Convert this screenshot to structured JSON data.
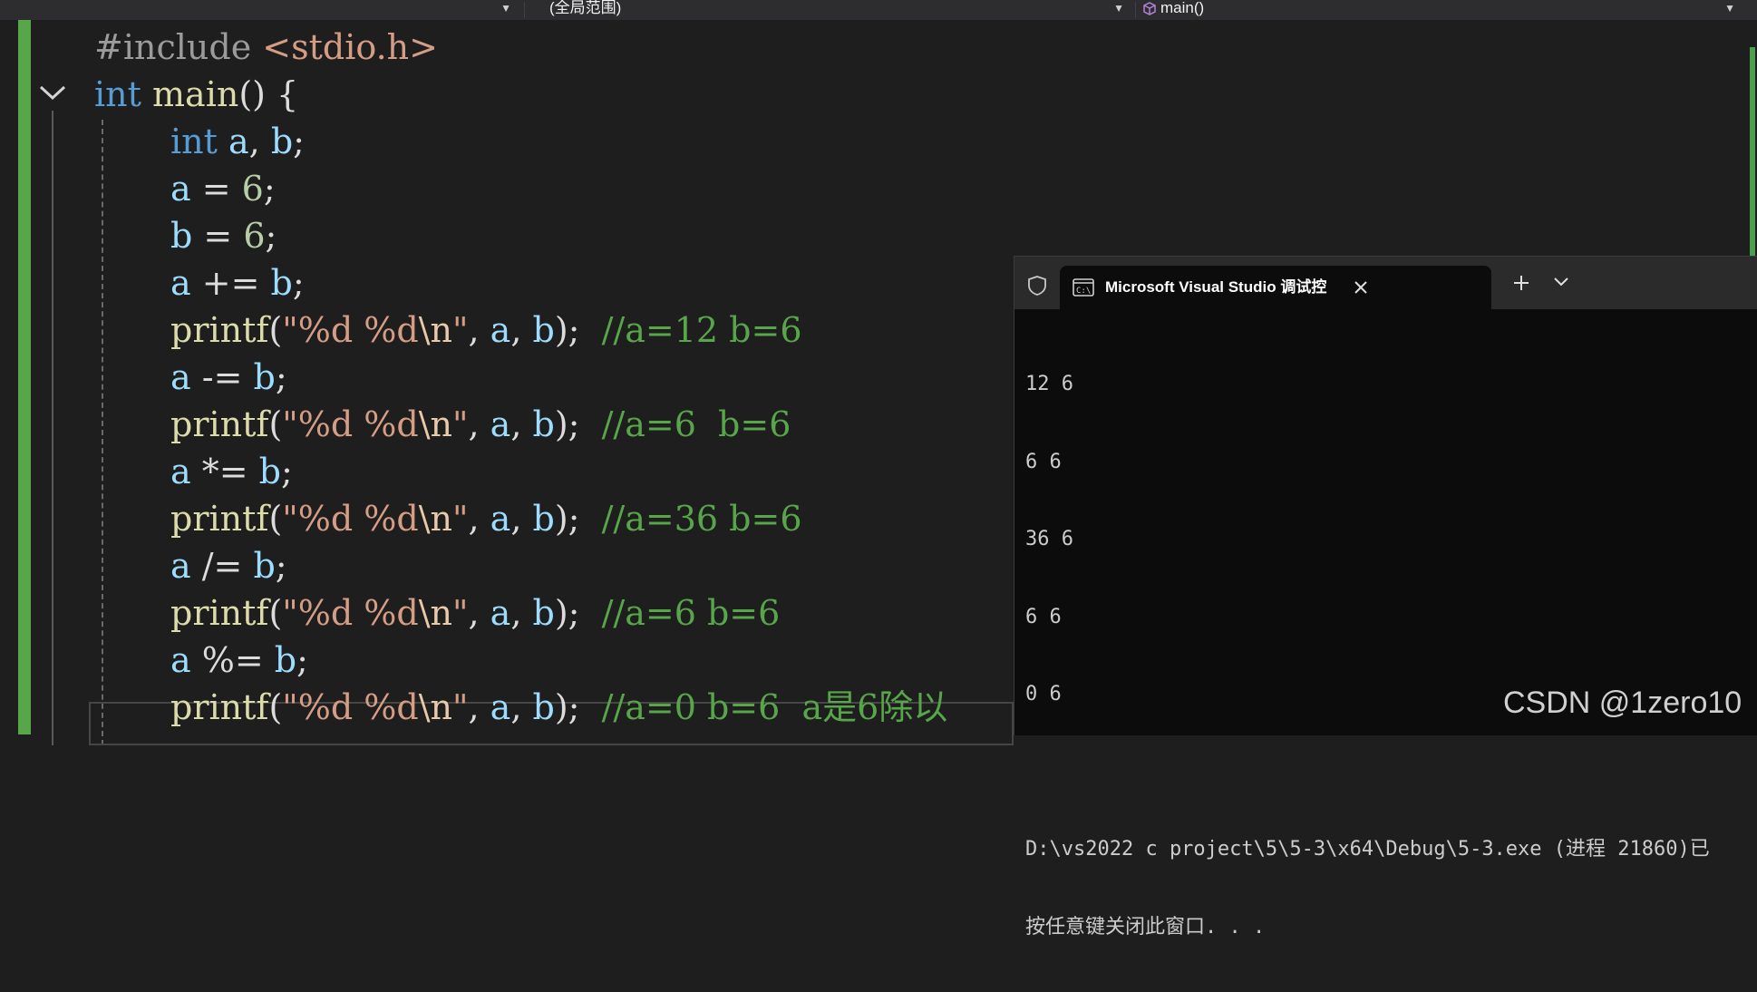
{
  "navbar": {
    "project_dropdown": "",
    "scope_dropdown": "(全局范围)",
    "member_dropdown": "main()",
    "member_icon": "cube-icon",
    "dropdown_icon": "dropdown-arrow-icon"
  },
  "editor": {
    "lines": [
      {
        "parts": [
          "#include ",
          "<stdio.h>"
        ]
      },
      {
        "parts": [
          "int",
          " ",
          "main",
          "() {"
        ]
      },
      {
        "parts": [
          "int",
          " ",
          "a",
          ", ",
          "b",
          ";"
        ]
      },
      {
        "parts": [
          "a",
          " = ",
          "6",
          ";"
        ]
      },
      {
        "parts": [
          "b",
          " = ",
          "6",
          ";"
        ]
      },
      {
        "parts": [
          "a",
          " += ",
          "b",
          ";"
        ]
      },
      {
        "parts": [
          "printf",
          "(",
          "\"%d %d",
          "\\n",
          "\"",
          ", ",
          "a",
          ", ",
          "b",
          ");",
          "  ",
          "//a=12 b=6"
        ]
      },
      {
        "parts": [
          "a",
          " -= ",
          "b",
          ";"
        ]
      },
      {
        "parts": [
          "printf",
          "(",
          "\"%d %d",
          "\\n",
          "\"",
          ", ",
          "a",
          ", ",
          "b",
          ");",
          "  ",
          "//a=6  b=6"
        ]
      },
      {
        "parts": [
          "a",
          " *= ",
          "b",
          ";"
        ]
      },
      {
        "parts": [
          "printf",
          "(",
          "\"%d %d",
          "\\n",
          "\"",
          ", ",
          "a",
          ", ",
          "b",
          ");",
          "  ",
          "//a=36 b=6"
        ]
      },
      {
        "parts": [
          "a",
          " /= ",
          "b",
          ";"
        ]
      },
      {
        "parts": [
          "printf",
          "(",
          "\"%d %d",
          "\\n",
          "\"",
          ", ",
          "a",
          ", ",
          "b",
          ");",
          "  ",
          "//a=6 b=6"
        ]
      },
      {
        "parts": [
          "a",
          " %= ",
          "b",
          ";"
        ]
      },
      {
        "parts": [
          "printf",
          "(",
          "\"%d %d",
          "\\n",
          "\"",
          ", ",
          "a",
          ", ",
          "b",
          ");",
          "  ",
          "//a=0 b=6  a是6除以"
        ]
      }
    ]
  },
  "terminal": {
    "tab_title": "Microsoft Visual Studio 调试控",
    "new_tab_label": "+",
    "output_lines": [
      "12 6",
      "6 6",
      "36 6",
      "6 6",
      "0 6",
      "",
      "D:\\vs2022 c project\\5\\5-3\\x64\\Debug\\5-3.exe (进程 21860)已",
      "按任意键关闭此窗口. . ."
    ]
  },
  "watermark": "CSDN @1zero10",
  "colors": {
    "background": "#1e1e1e",
    "keyword": "#569cd6",
    "function": "#dcdcaa",
    "variable": "#9cdcfe",
    "number": "#b5cea8",
    "string": "#d69d85",
    "comment": "#57a64a",
    "change_bar": "#57a64a"
  }
}
